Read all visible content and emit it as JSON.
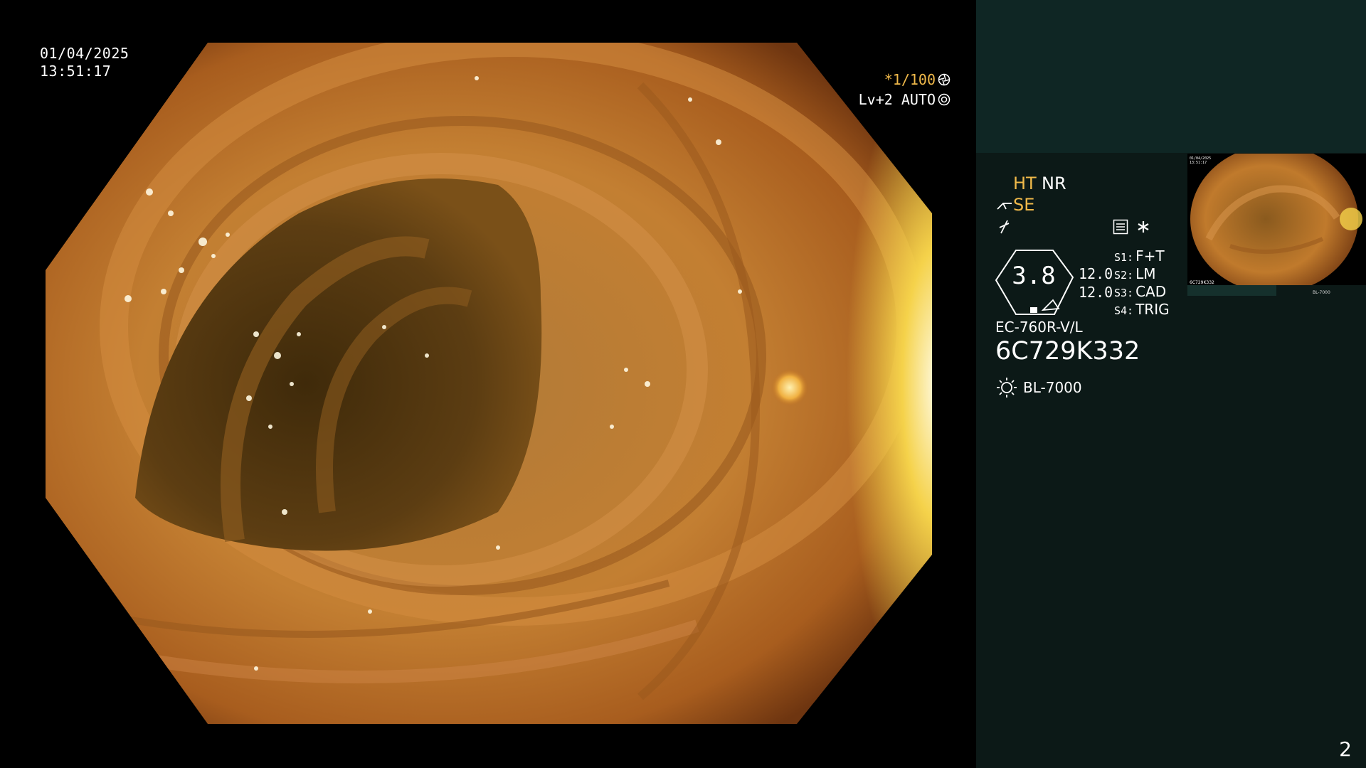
{
  "overlay": {
    "date": "01/04/2025",
    "time": "13:51:17",
    "shutter": "*1/100",
    "level": "Lv+2 AUTO"
  },
  "panel": {
    "ht": "HT",
    "nr": "NR",
    "se": "SE",
    "zoom": "3.8",
    "enh1": "12.0",
    "enh2": "12.0",
    "slots": [
      {
        "key": "S1:",
        "value": "F+T"
      },
      {
        "key": "S2:",
        "value": "LM"
      },
      {
        "key": "S3:",
        "value": "CAD"
      },
      {
        "key": "S4:",
        "value": "TRIG"
      }
    ],
    "scope_model": "EC-760R-V/L",
    "scope_serial": "6C729K332",
    "light_source": "BL-7000",
    "thumbnail_date": "01/04/2025",
    "thumbnail_time": "13:51:17",
    "thumbnail_serial": "6C729K332",
    "thumbnail_label": "BL-7000"
  },
  "page_number": "2",
  "colors": {
    "accent": "#f0b94a",
    "panel_bg": "#0c1917",
    "panel_top": "#0f2624",
    "mucosa": "#c07a2c"
  },
  "icons": [
    "shutter-icon",
    "auto-iris-icon",
    "scissors-icon",
    "flash-icon",
    "menu-icon",
    "asterisk-icon",
    "light-source-icon"
  ]
}
